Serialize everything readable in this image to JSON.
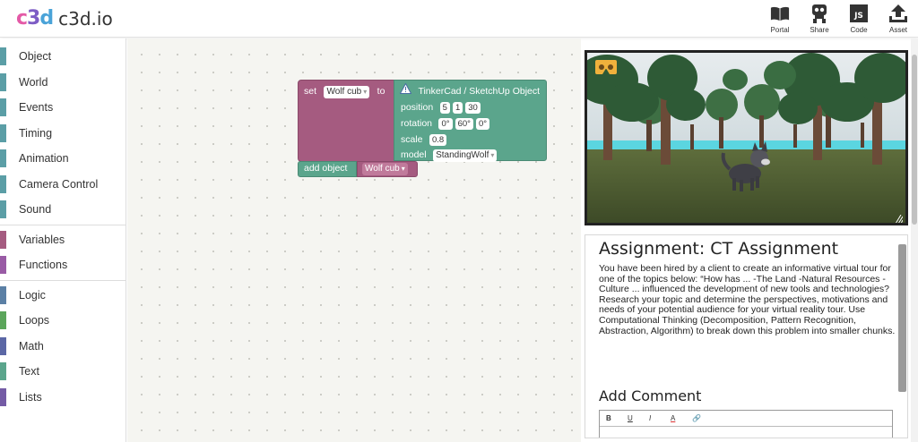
{
  "header": {
    "logo_mark": "c3d",
    "logo_text": "c3d.io",
    "tools": [
      {
        "label": "Portal",
        "icon": "book-icon"
      },
      {
        "label": "Share",
        "icon": "share-icon"
      },
      {
        "label": "Code",
        "icon": "js-icon",
        "icon_text": "JS"
      },
      {
        "label": "Asset",
        "icon": "upload-icon"
      }
    ]
  },
  "sidebar": {
    "groups": [
      [
        {
          "label": "Object",
          "color": "#5b9ea6"
        },
        {
          "label": "World",
          "color": "#5b9ea6"
        },
        {
          "label": "Events",
          "color": "#5b9ea6"
        },
        {
          "label": "Timing",
          "color": "#5b9ea6"
        },
        {
          "label": "Animation",
          "color": "#5b9ea6"
        },
        {
          "label": "Camera Control",
          "color": "#5b9ea6"
        },
        {
          "label": "Sound",
          "color": "#5b9ea6"
        }
      ],
      [
        {
          "label": "Variables",
          "color": "#a55b80"
        },
        {
          "label": "Functions",
          "color": "#995ba5"
        }
      ],
      [
        {
          "label": "Logic",
          "color": "#5b80a5"
        },
        {
          "label": "Loops",
          "color": "#5ba55b"
        },
        {
          "label": "Math",
          "color": "#5b67a5"
        },
        {
          "label": "Text",
          "color": "#5ba58c"
        },
        {
          "label": "Lists",
          "color": "#745ba5"
        }
      ]
    ]
  },
  "blocks": {
    "set_label": "set",
    "set_var": "Wolf cub",
    "to_label": "to",
    "object_title": "TinkerCad / SketchUp Object",
    "position_label": "position",
    "position": [
      "5",
      "1",
      "30"
    ],
    "rotation_label": "rotation",
    "rotation": [
      "0°",
      "60°",
      "0°"
    ],
    "scale_label": "scale",
    "scale": "0.8",
    "model_label": "model",
    "model": "StandingWolf",
    "add_label": "add object",
    "add_var": "Wolf cub",
    "colors": {
      "variable": "#a55b80",
      "object": "#5ba58c"
    }
  },
  "view3d": {
    "vr_icon": "cardboard-icon",
    "resize_icon": "resize-icon"
  },
  "assignment": {
    "title": "Assignment: CT Assignment",
    "body": "You have been hired by a client to create an informative virtual tour for one of the topics below: “How has ... -The Land -Natural Resources -Culture ... influenced the development of new tools and technologies? Research your topic and determine the perspectives, motivations and needs of your potential audience for your virtual reality tour. Use Computational Thinking (Decomposition, Pattern Recognition, Abstraction, Algorithm) to break down this problem into smaller chunks.",
    "comment_title": "Add Comment",
    "editor_buttons": [
      "B",
      "U",
      "I",
      "A",
      "🔗"
    ]
  }
}
